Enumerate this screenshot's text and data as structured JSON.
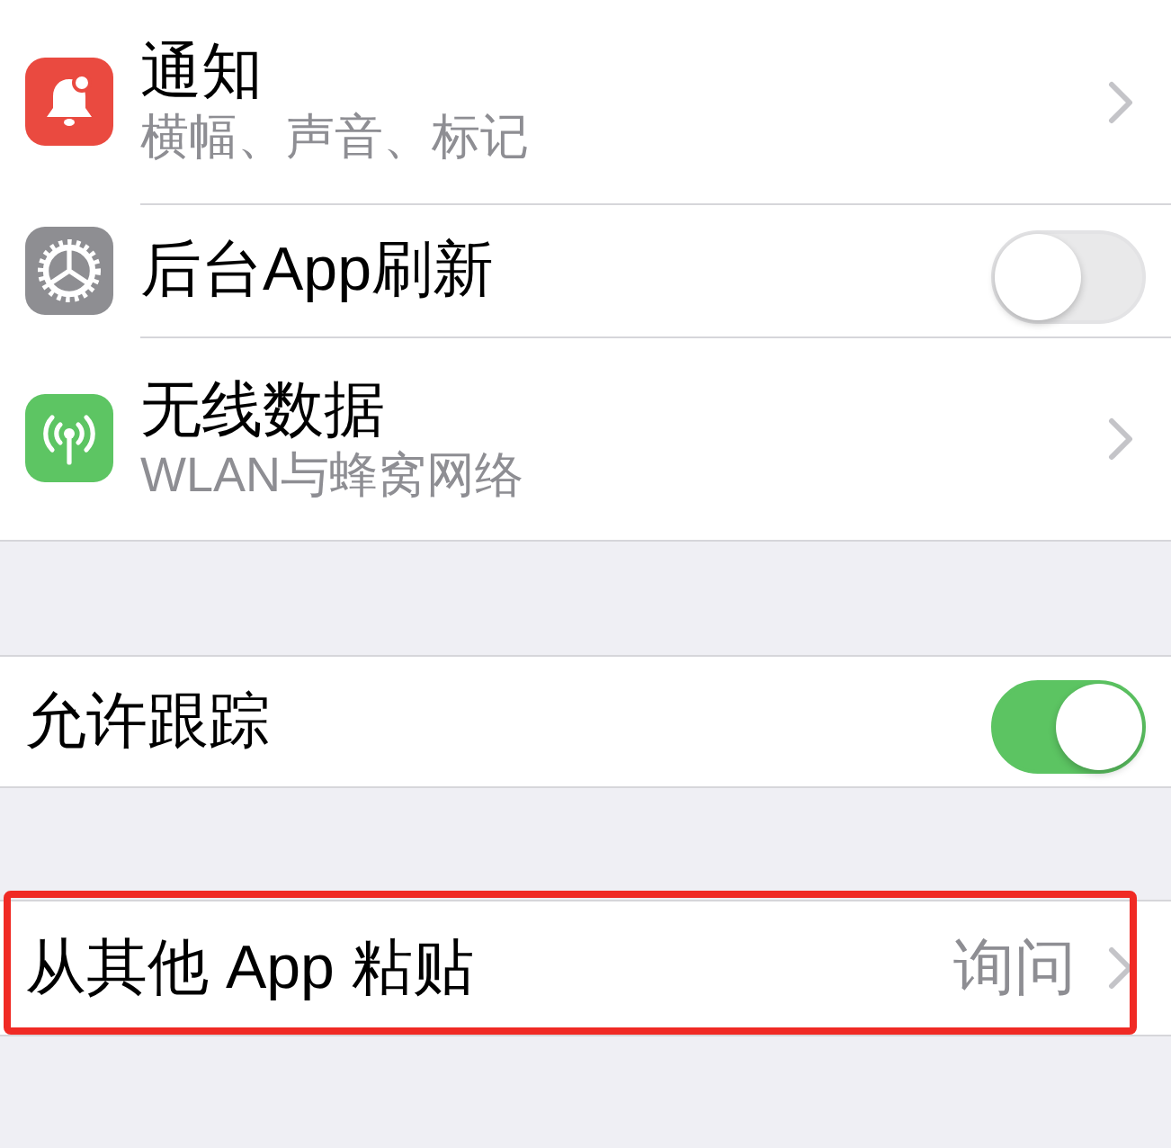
{
  "groups": [
    {
      "rows": [
        {
          "kind": "link",
          "color": "#ea4a40",
          "title": "通知",
          "subtitle": "横幅、声音、标记"
        },
        {
          "kind": "toggle",
          "color": "#8e8e92",
          "title": "后台App刷新",
          "on": false
        },
        {
          "kind": "link",
          "color": "#5dc563",
          "title": "无线数据",
          "subtitle": "WLAN与蜂窝网络"
        }
      ]
    },
    {
      "rows": [
        {
          "kind": "toggle",
          "title": "允许跟踪",
          "on": true
        }
      ]
    },
    {
      "rows": [
        {
          "kind": "link",
          "title": "从其他 App 粘贴",
          "value": "询问",
          "highlighted": true
        }
      ]
    }
  ]
}
